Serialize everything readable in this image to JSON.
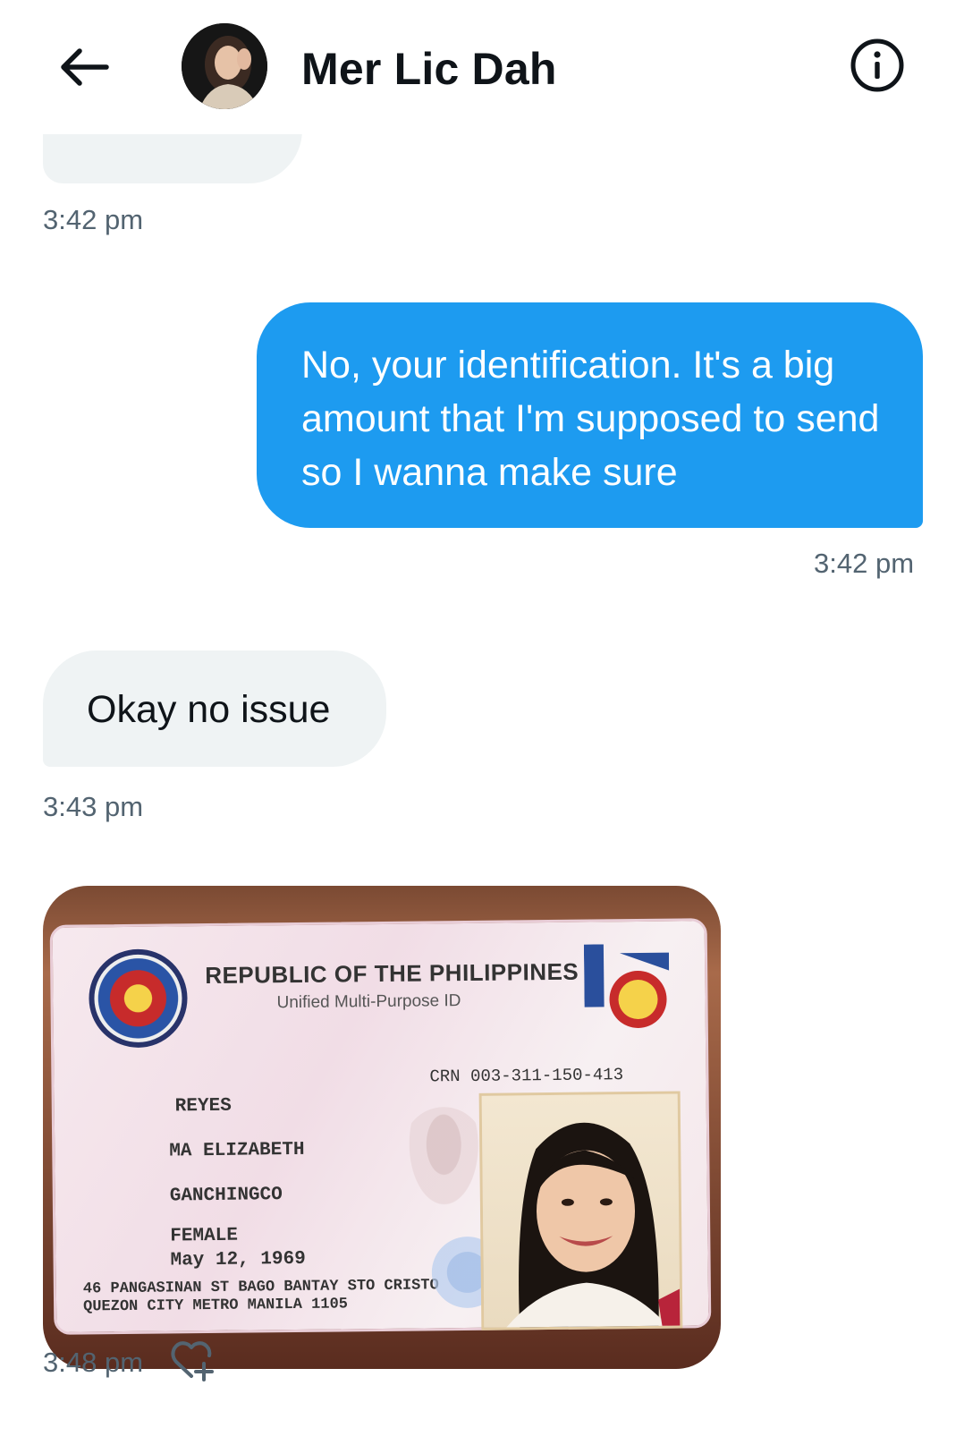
{
  "header": {
    "back_icon": "arrow-left-icon",
    "contact_name": "Mer Lic Dah",
    "info_icon": "info-circle-icon"
  },
  "messages": [
    {
      "direction": "in",
      "text": "",
      "time": "3:42 pm",
      "partial": true
    },
    {
      "direction": "out",
      "text": "No, your identification. It's a big amount that I'm supposed to send so I wanna make sure",
      "time": "3:42 pm"
    },
    {
      "direction": "in",
      "text": "Okay no issue",
      "time": "3:43 pm"
    },
    {
      "direction": "in",
      "type": "image",
      "time": "3:48 pm",
      "reaction_icon": "heart-plus-icon",
      "image": {
        "header": "REPUBLIC OF THE PHILIPPINES",
        "subheader": "Unified Multi-Purpose ID",
        "crn": "003-311-150-413",
        "surname": "REYES",
        "given_name": "MA ELIZABETH",
        "middle_name": "GANCHINGCO",
        "sex": "FEMALE",
        "dob": "May 12, 1969",
        "address": "46 PANGASINAN ST BAGO BANTAY STO CRISTO QUEZON CITY METRO MANILA 1105"
      }
    }
  ],
  "colors": {
    "outgoing_bubble": "#1d9bf0",
    "incoming_bubble": "#eff3f4",
    "timestamp": "#536471"
  }
}
